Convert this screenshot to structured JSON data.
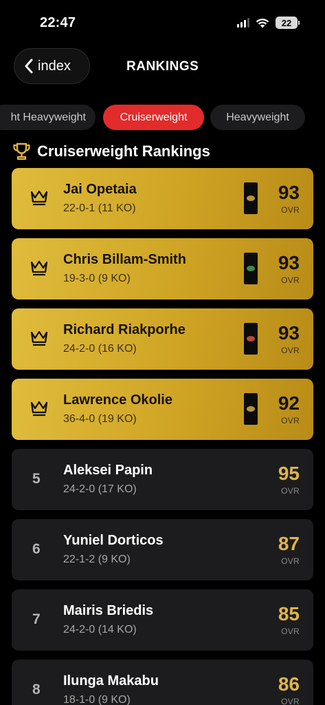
{
  "status": {
    "time": "22:47",
    "battery": "22"
  },
  "nav": {
    "back_label": "index",
    "title": "RANKINGS"
  },
  "tabs": [
    "ht Heavyweight",
    "Cruiserweight",
    "Heavyweight"
  ],
  "section": {
    "title": "Cruiserweight Rankings"
  },
  "colors": {
    "gold": "#d4ab2c",
    "accent_red": "#e22b2b",
    "card_dark": "#1c1c1e",
    "ovr_gold": "#e0b54a"
  },
  "ovr_label": "OVR",
  "champions": [
    {
      "name": "Jai Opetaia",
      "record": "22-0-1 (11 KO)",
      "ovr": "93",
      "belt_color": "#b9923a"
    },
    {
      "name": "Chris Billam-Smith",
      "record": "19-3-0 (9 KO)",
      "ovr": "93",
      "belt_color": "#3f8a4f"
    },
    {
      "name": "Richard Riakporhe",
      "record": "24-2-0 (16 KO)",
      "ovr": "93",
      "belt_color": "#b54a3a"
    },
    {
      "name": "Lawrence Okolie",
      "record": "36-4-0 (19 KO)",
      "ovr": "92",
      "belt_color": "#b9923a"
    }
  ],
  "ranked": [
    {
      "rank": "5",
      "name": "Aleksei Papin",
      "record": "24-2-0 (17 KO)",
      "ovr": "95"
    },
    {
      "rank": "6",
      "name": "Yuniel Dorticos",
      "record": "22-1-2 (9 KO)",
      "ovr": "87"
    },
    {
      "rank": "7",
      "name": "Mairis Briedis",
      "record": "24-2-0 (14 KO)",
      "ovr": "85"
    },
    {
      "rank": "8",
      "name": "Ilunga Makabu",
      "record": "18-1-0 (9 KO)",
      "ovr": "86"
    }
  ]
}
